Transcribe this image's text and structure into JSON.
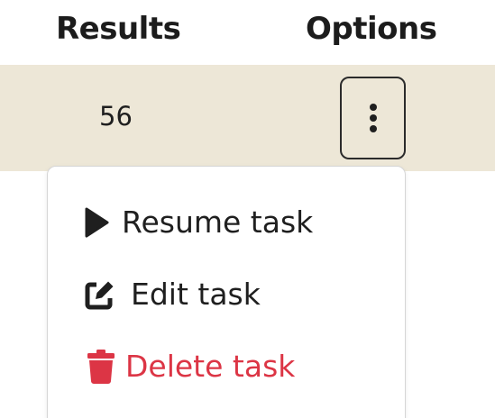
{
  "table": {
    "columns": [
      "Results",
      "Options"
    ],
    "row": {
      "results": "56"
    }
  },
  "options_button": {
    "icon": "vertical-ellipsis-icon"
  },
  "menu": {
    "items": [
      {
        "label": "Resume task",
        "icon": "play-icon",
        "color": "#1f1f1f"
      },
      {
        "label": "Edit task",
        "icon": "edit-square-icon",
        "color": "#1f1f1f"
      },
      {
        "label": "Delete task",
        "icon": "trash-icon",
        "color": "#dc3545"
      }
    ]
  },
  "colors": {
    "row_background": "#ede7d7",
    "danger": "#dc3545",
    "text": "#1f1f1f"
  }
}
